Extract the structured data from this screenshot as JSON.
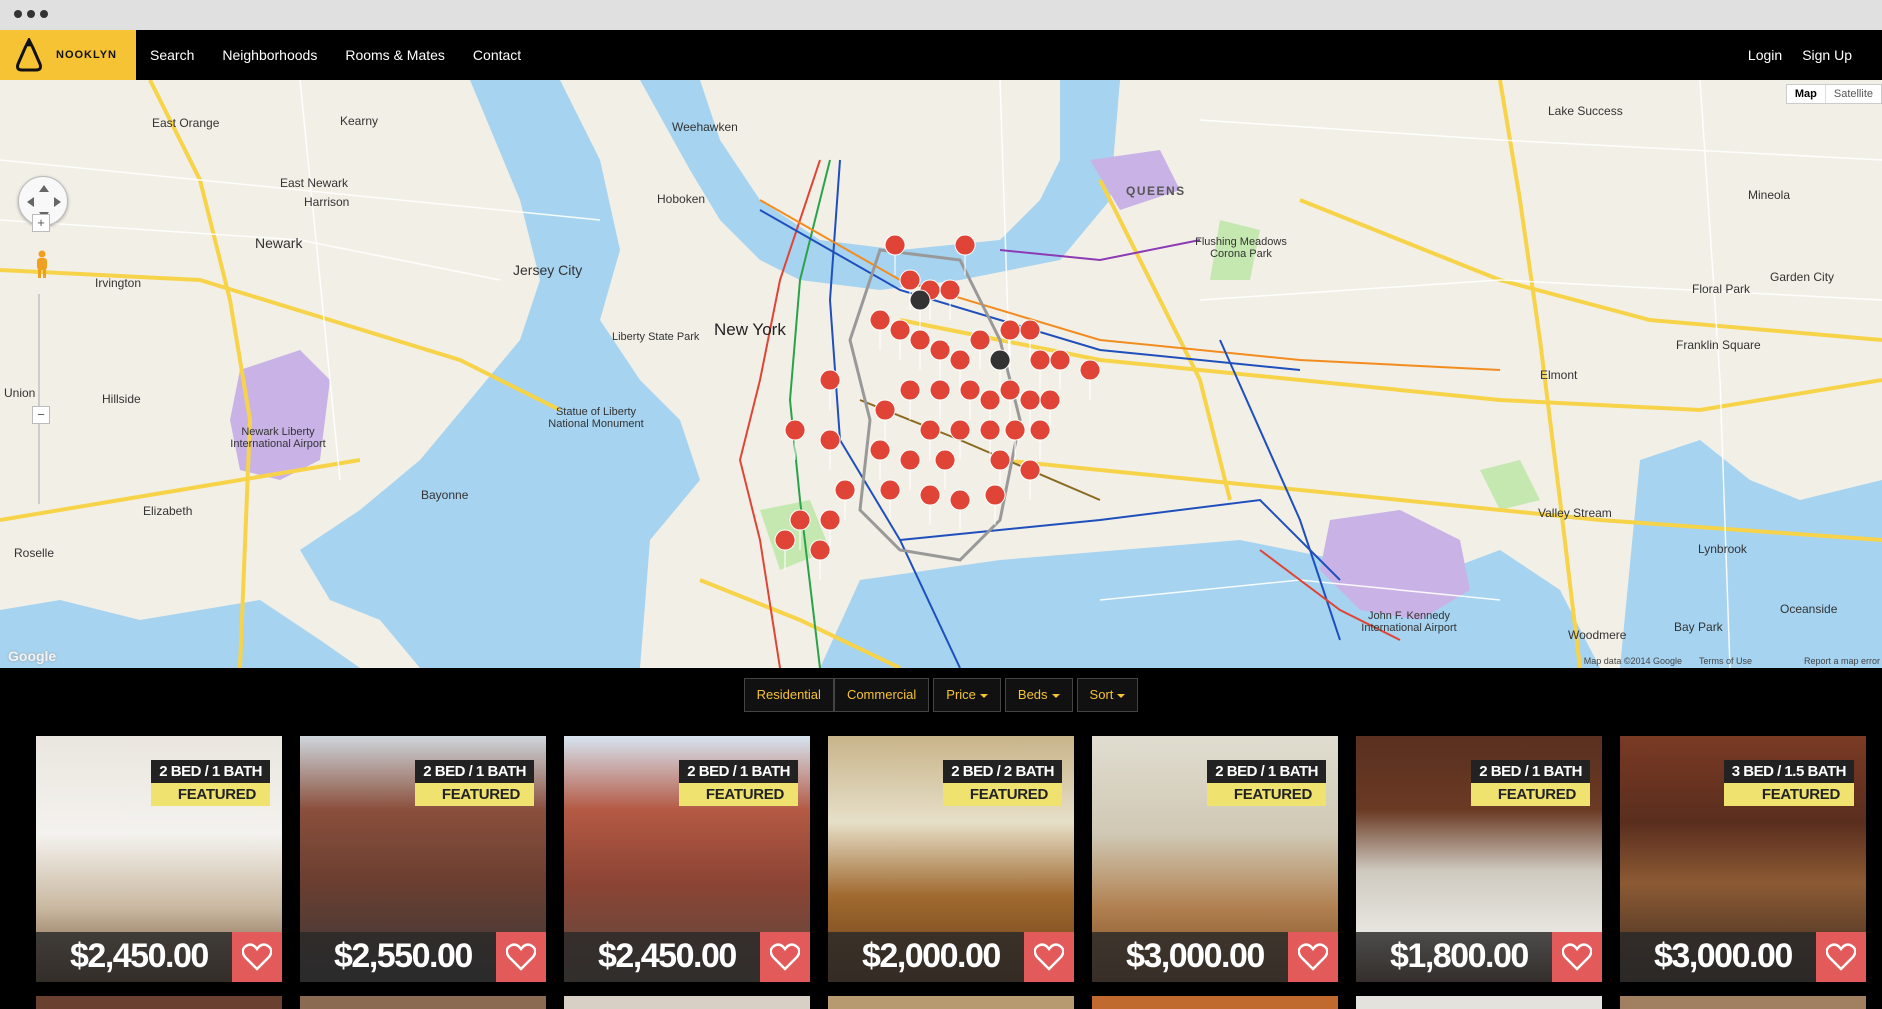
{
  "nav": {
    "logo_text": "NOOKLYN",
    "links": [
      "Search",
      "Neighborhoods",
      "Rooms & Mates",
      "Contact"
    ],
    "login": "Login",
    "signup": "Sign Up"
  },
  "map": {
    "type_map": "Map",
    "type_satellite": "Satellite",
    "attribution": "Map data ©2014 Google",
    "terms": "Terms of Use",
    "report": "Report a map error",
    "google": "Google",
    "labels": {
      "new_york": "New York",
      "newark": "Newark",
      "jersey_city": "Jersey City",
      "east_orange": "East Orange",
      "queens": "QUEENS",
      "hoboken": "Hoboken",
      "bayonne": "Bayonne",
      "elizabeth": "Elizabeth",
      "floral_park": "Floral Park",
      "elmont": "Elmont",
      "harrison": "Harrison",
      "kearny": "Kearny",
      "weehawken": "Weehawken",
      "irvington": "Irvington",
      "hillside": "Hillside",
      "union": "Union",
      "roselle": "Roselle",
      "east_newark": "East Newark",
      "lake_success": "Lake Success",
      "mineola": "Mineola",
      "garden_city": "Garden City",
      "franklin_square": "Franklin Square",
      "valley_stream": "Valley Stream",
      "lynbrook": "Lynbrook",
      "bay_park": "Bay Park",
      "woodmere": "Woodmere",
      "oceanside": "Oceanside",
      "statue": "Statue of Liberty National Monument",
      "liberty_park": "Liberty State Park",
      "newark_airport": "Newark Liberty International Airport",
      "jfk": "John F. Kennedy International Airport",
      "flushing_meadows": "Flushing Meadows Corona Park"
    }
  },
  "filters": {
    "residential": "Residential",
    "commercial": "Commercial",
    "price": "Price",
    "beds": "Beds",
    "sort": "Sort"
  },
  "listings": [
    {
      "beds": "2 BED / 1 BATH",
      "badge": "FEATURED",
      "price": "$2,450.00"
    },
    {
      "beds": "2 BED / 1 BATH",
      "badge": "FEATURED",
      "price": "$2,550.00"
    },
    {
      "beds": "2 BED / 1 BATH",
      "badge": "FEATURED",
      "price": "$2,450.00"
    },
    {
      "beds": "2 BED / 2 BATH",
      "badge": "FEATURED",
      "price": "$2,000.00"
    },
    {
      "beds": "2 BED / 1 BATH",
      "badge": "FEATURED",
      "price": "$3,000.00"
    },
    {
      "beds": "2 BED / 1 BATH",
      "badge": "FEATURED",
      "price": "$1,800.00"
    },
    {
      "beds": "3 BED / 1.5 BATH",
      "badge": "FEATURED",
      "price": "$3,000.00"
    }
  ],
  "colors": {
    "brand": "#f6c335",
    "pin": "#e04436",
    "heart": "#e35a5a",
    "featured": "#f0e26f"
  }
}
